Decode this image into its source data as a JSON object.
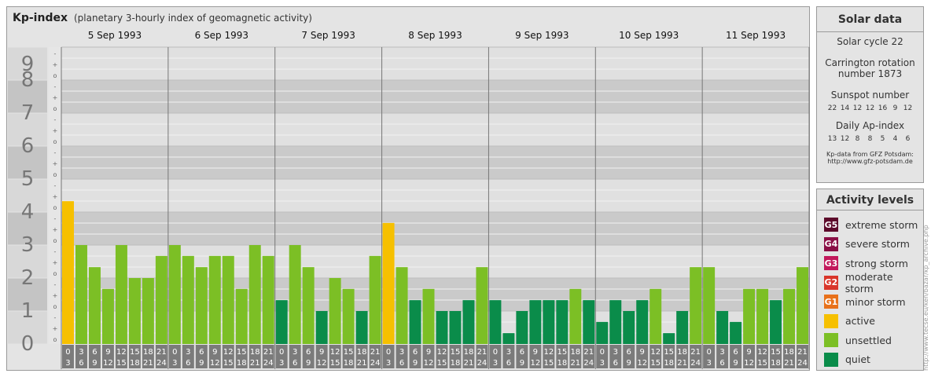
{
  "header": {
    "title": "Kp-index",
    "subtitle": "(planetary 3-hourly index of geomagnetic activity)"
  },
  "solar_data": {
    "title": "Solar data",
    "solar_cycle": "Solar cycle 22",
    "carrington_line1": "Carrington rotation",
    "carrington_line2": "number 1873",
    "sunspot_label": "Sunspot number",
    "sunspot_values": [
      "22",
      "14",
      "12",
      "12",
      "16",
      "9",
      "12"
    ],
    "ap_label": "Daily Ap-index",
    "ap_values": [
      "13",
      "12",
      "8",
      "8",
      "5",
      "4",
      "6"
    ],
    "source_line1": "Kp-data from GFZ Potsdam:",
    "source_line2": "http://www.gfz-potsdam.de"
  },
  "activity_levels": {
    "title": "Activity levels",
    "items": [
      {
        "badge": "G5",
        "label": "extreme storm",
        "color": "#5c0a2a"
      },
      {
        "badge": "G4",
        "label": "severe storm",
        "color": "#8a0f45"
      },
      {
        "badge": "G3",
        "label": "strong storm",
        "color": "#c2185b"
      },
      {
        "badge": "G2",
        "label": "moderate storm",
        "color": "#d9362a"
      },
      {
        "badge": "G1",
        "label": "minor storm",
        "color": "#e8711a"
      },
      {
        "badge": "",
        "label": "active",
        "color": "#f6c000"
      },
      {
        "badge": "",
        "label": "unsettled",
        "color": "#7cbf25"
      },
      {
        "badge": "",
        "label": "quiet",
        "color": "#0a8c4a"
      }
    ]
  },
  "watermark": "http://www.tecse.eu/ken/bazar/kp_archive.php",
  "chart_data": {
    "type": "bar",
    "title": "Kp-index",
    "ylim": [
      0,
      9
    ],
    "y_ticks": [
      "0",
      "1",
      "2",
      "3",
      "4",
      "5",
      "6",
      "7",
      "8",
      "9"
    ],
    "y_minor": [
      "o",
      "+",
      "-"
    ],
    "days": [
      "5 Sep 1993",
      "6 Sep 1993",
      "7 Sep 1993",
      "8 Sep 1993",
      "9 Sep 1993",
      "10 Sep 1993",
      "11 Sep 1993"
    ],
    "interval_start": [
      "0",
      "3",
      "6",
      "9",
      "12",
      "15",
      "18",
      "21"
    ],
    "interval_end": [
      "3",
      "6",
      "9",
      "12",
      "15",
      "18",
      "21",
      "24"
    ],
    "values": [
      [
        4.33,
        3.0,
        2.33,
        1.67,
        3.0,
        2.0,
        2.0,
        2.67
      ],
      [
        3.0,
        2.67,
        2.33,
        2.67,
        2.67,
        1.67,
        3.0,
        2.67
      ],
      [
        1.33,
        3.0,
        2.33,
        1.0,
        2.0,
        1.67,
        1.0,
        2.67
      ],
      [
        3.67,
        2.33,
        1.33,
        1.67,
        1.0,
        1.0,
        1.33,
        2.33
      ],
      [
        1.33,
        0.33,
        1.0,
        1.33,
        1.33,
        1.33,
        1.67,
        1.33
      ],
      [
        0.67,
        1.33,
        1.0,
        1.33,
        1.67,
        0.33,
        1.0,
        2.33
      ],
      [
        2.33,
        1.0,
        0.67,
        1.67,
        1.67,
        1.33,
        1.67,
        2.33
      ]
    ],
    "colors": {
      "quiet": "#0a8c4a",
      "unsettled": "#7cbf25",
      "active": "#f6c000"
    }
  }
}
